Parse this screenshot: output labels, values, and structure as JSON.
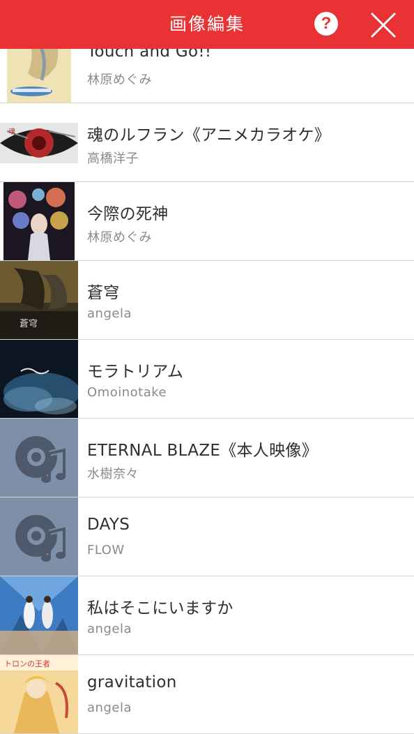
{
  "header": {
    "title": "画像編集",
    "help_label": "?",
    "close_icon": "close-icon",
    "color": "#e83234"
  },
  "songs": [
    {
      "title": "Touch and Go!!",
      "artist": "林原めぐみ",
      "art": "yellow-anime-cover"
    },
    {
      "title": "魂のルフラン《アニメカラオケ》",
      "artist": "高橋洋子",
      "art": "red-eye-cover"
    },
    {
      "title": "今際の死神",
      "artist": "林原めぐみ",
      "art": "flower-portrait-cover"
    },
    {
      "title": "蒼穹",
      "artist": "angela",
      "art": "dark-mecha-cover"
    },
    {
      "title": "モラトリアム",
      "artist": "Omoinotake",
      "art": "blue-smoke-cover"
    },
    {
      "title": "ETERNAL BLAZE《本人映像》",
      "artist": "水樹奈々",
      "art": "music-disc-placeholder-icon"
    },
    {
      "title": "DAYS",
      "artist": "FLOW",
      "art": "music-disc-placeholder-icon"
    },
    {
      "title": "私はそこにいますか",
      "artist": "angela",
      "art": "duo-sky-cover"
    },
    {
      "title": "gravitation",
      "artist": "angela",
      "art": "anime-girls-cover"
    }
  ]
}
